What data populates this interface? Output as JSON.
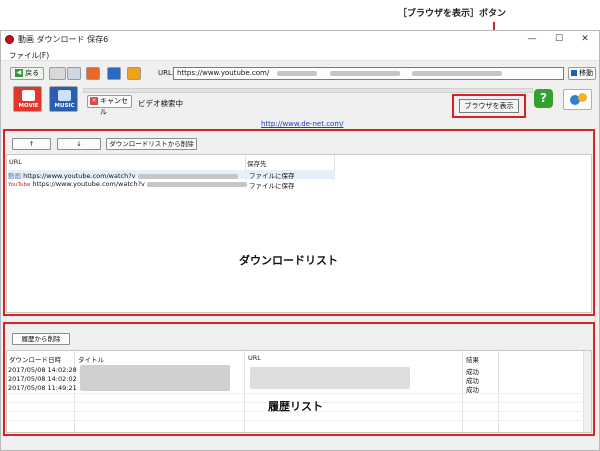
{
  "annotation": {
    "browser_button_callout": "［ブラウザを表示］ボタン"
  },
  "window": {
    "title": "動画 ダウンロード 保存6",
    "controls": {
      "minimize": "—",
      "maximize": "☐",
      "close": "✕"
    }
  },
  "menu": {
    "file": "ファイル(F)"
  },
  "toolbar": {
    "back_label": "戻る",
    "url_label": "URL:",
    "url_value": "https://www.youtube.com/",
    "go_label": "移動"
  },
  "mode_buttons": {
    "movie": "MOVIE",
    "music": "MUSIC"
  },
  "actions": {
    "cancel_label": "キャンセル",
    "status": "ビデオ検索中",
    "show_browser_label": "ブラウザを表示"
  },
  "site_link": "http://www.de-net.com/",
  "download_panel": {
    "up_label": "↑",
    "down_label": "↓",
    "remove_label": "ダウンロードリストから削除",
    "columns": {
      "url": "URL",
      "save_to": "保存先"
    },
    "rows": [
      {
        "source": "動画",
        "url": "https://www.youtube.com/watch?v",
        "save_to": "ファイルに保存"
      },
      {
        "source": "YouTube",
        "url": "https://www.youtube.com/watch?v",
        "save_to": "ファイルに保存"
      }
    ],
    "overlay_label": "ダウンロードリスト"
  },
  "history_panel": {
    "remove_label": "履歴から削除",
    "columns": {
      "date": "ダウンロード日時",
      "title": "タイトル",
      "url": "URL",
      "result": "結果"
    },
    "rows": [
      {
        "date": "2017/05/08 14:02:28",
        "result": "成功"
      },
      {
        "date": "2017/05/08 14:02:02",
        "result": "成功"
      },
      {
        "date": "2017/05/08 11:49:21",
        "result": "成功"
      }
    ],
    "overlay_label": "履歴リスト"
  },
  "colors": {
    "highlight": "#d9212a",
    "accent_blue": "#1e5fb4",
    "link": "#1a3dc8"
  }
}
